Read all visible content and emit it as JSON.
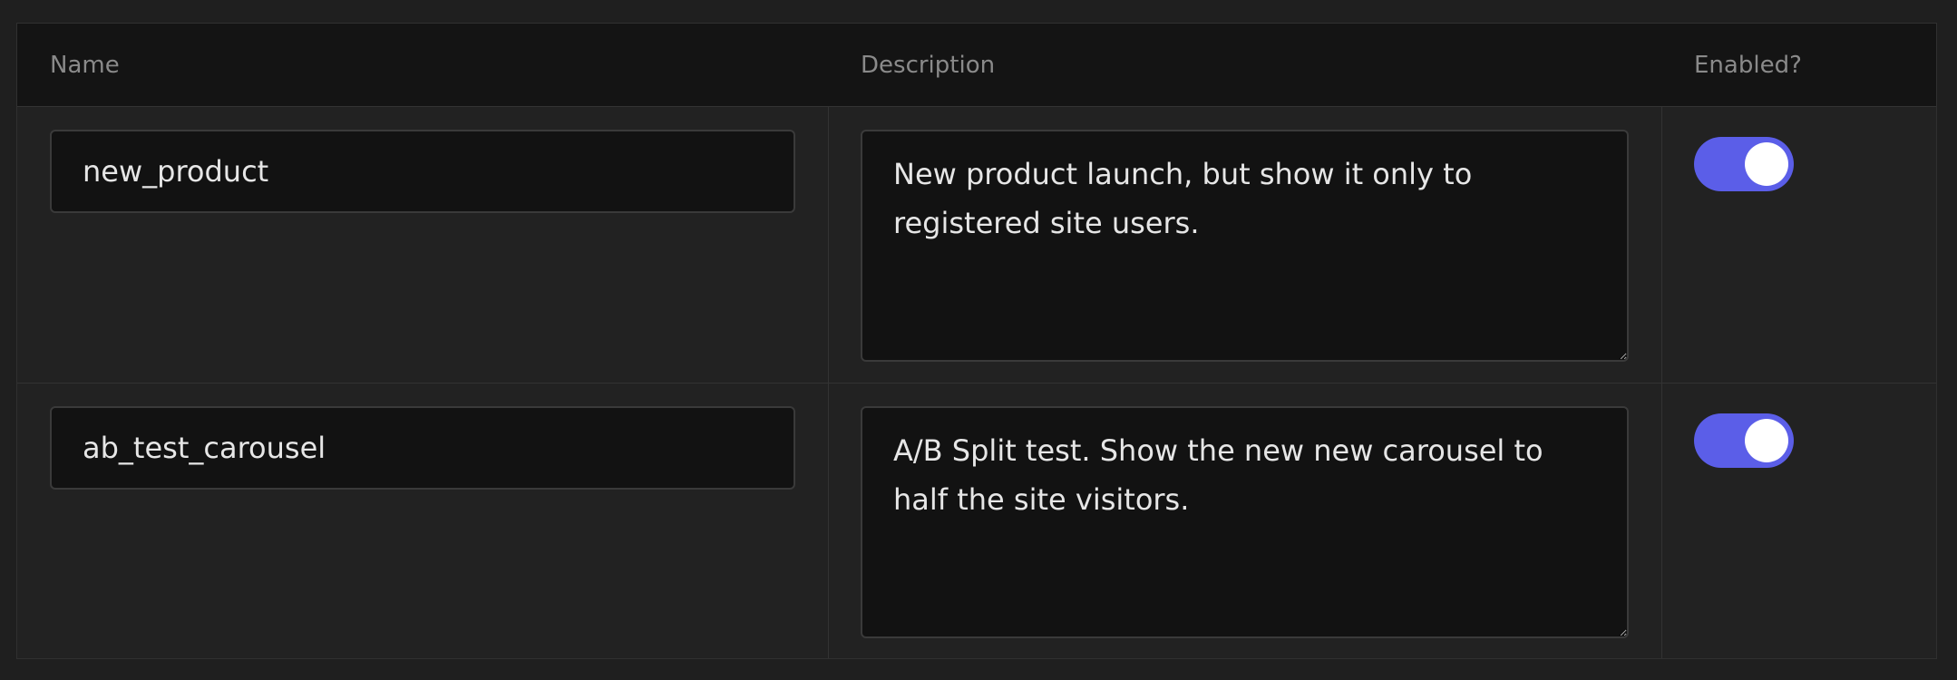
{
  "table": {
    "headers": {
      "name": "Name",
      "description": "Description",
      "enabled": "Enabled?"
    },
    "rows": [
      {
        "name": "new_product",
        "description": "New product launch, but show it only to registered site users.",
        "enabled": true
      },
      {
        "name": "ab_test_carousel",
        "description": "A/B Split test. Show the new new carousel to half the site visitors.",
        "enabled": true
      }
    ]
  },
  "colors": {
    "toggle_on": "#5b5ee8",
    "background": "#1f1f1f",
    "input_background": "#121212"
  }
}
